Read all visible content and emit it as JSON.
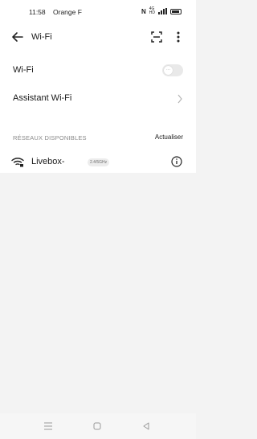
{
  "status_bar": {
    "time": "11:58",
    "carrier": "Orange F",
    "nfc": "N",
    "network_top": "4G",
    "network_bottom": "HD"
  },
  "header": {
    "title": "Wi-Fi"
  },
  "settings": {
    "wifi_label": "Wi-Fi",
    "wifi_enabled": false,
    "assistant_label": "Assistant Wi-Fi"
  },
  "networks": {
    "section_title": "RÉSEAUX DISPONIBLES",
    "refresh_label": "Actualiser",
    "items": [
      {
        "ssid": "Livebox-",
        "band": "2.4/5GHz"
      }
    ]
  },
  "icons": {
    "back": "back-arrow-icon",
    "qr": "qr-scan-icon",
    "more": "more-vert-icon",
    "chevron": "chevron-right-icon",
    "wifi": "wifi-lock-icon",
    "info": "info-icon"
  },
  "colors": {
    "background": "#f3f3f3",
    "surface": "#ffffff",
    "secondary_text": "#8a8a8a"
  }
}
